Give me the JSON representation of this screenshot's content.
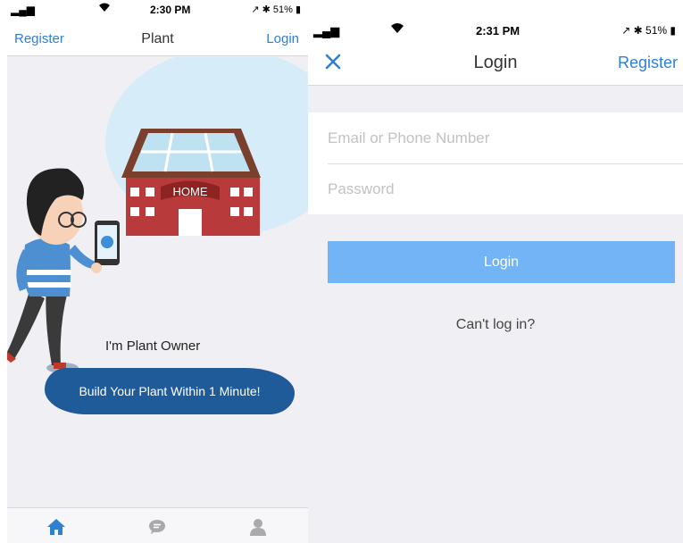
{
  "left_screen": {
    "status": {
      "signal": "▂▄▆",
      "wifi": "▼",
      "time": "2:30 PM",
      "right": "↗ ✱ 51% ▮"
    },
    "nav": {
      "left_link": "Register",
      "title": "Plant",
      "right_link": "Login"
    },
    "illustration": {
      "house_sign": "HOME"
    },
    "owner_text": "I'm Plant Owner",
    "build_button": "Build Your Plant Within 1 Minute!",
    "tabs": [
      {
        "icon": "home-icon"
      },
      {
        "icon": "message-icon"
      },
      {
        "icon": "person-icon"
      }
    ]
  },
  "right_screen": {
    "status": {
      "signal": "▂▄▆",
      "wifi": "▼",
      "time": "2:31 PM",
      "right": "↗ ✱ 51% ▮"
    },
    "nav": {
      "close_icon": "close-icon",
      "title": "Login",
      "right_link": "Register"
    },
    "form": {
      "email_placeholder": "Email or Phone Number",
      "password_placeholder": "Password"
    },
    "login_button": "Login",
    "cant_login": "Can't log in?"
  },
  "colors": {
    "link_blue": "#2f80d0",
    "login_button": "#72b4f5",
    "build_button": "#1f5a99",
    "background": "#efeff4"
  }
}
